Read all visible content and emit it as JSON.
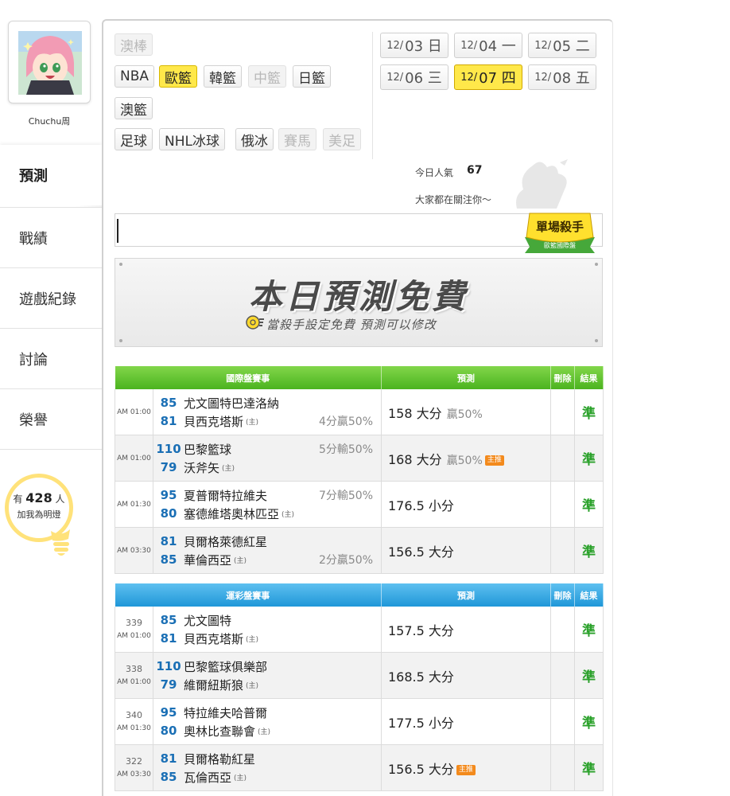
{
  "user": {
    "name": "Chuchu周"
  },
  "nav": [
    {
      "label": "預測",
      "active": true
    },
    {
      "label": "戰績"
    },
    {
      "label": "遊戲紀錄"
    },
    {
      "label": "討論"
    },
    {
      "label": "榮譽"
    }
  ],
  "fans": {
    "prefix": "有",
    "count": "428",
    "suffix": "人",
    "line2": "加我為明燈"
  },
  "sports": [
    {
      "label": "澳棒",
      "state": "disabled"
    },
    {
      "label": "NBA",
      "state": "normal"
    },
    {
      "label": "歐籃",
      "state": "selected"
    },
    {
      "label": "韓籃",
      "state": "normal"
    },
    {
      "label": "中籃",
      "state": "disabled"
    },
    {
      "label": "日籃",
      "state": "normal"
    },
    {
      "label": "澳籃",
      "state": "normal"
    },
    {
      "label": "足球",
      "state": "normal"
    },
    {
      "label": "NHL冰球",
      "state": "normal"
    },
    {
      "label": "俄冰",
      "state": "normal"
    },
    {
      "label": "賽馬",
      "state": "disabled"
    },
    {
      "label": "美足",
      "state": "disabled"
    }
  ],
  "dates": [
    {
      "md": "12/",
      "d": "03 日"
    },
    {
      "md": "12/",
      "d": "04 一"
    },
    {
      "md": "12/",
      "d": "05 二"
    },
    {
      "md": "12/",
      "d": "06 三"
    },
    {
      "md": "12/",
      "d": "07 四",
      "selected": true
    },
    {
      "md": "12/",
      "d": "08 五"
    }
  ],
  "popularity": {
    "label": "今日人氣",
    "value": "67",
    "sub": "大家都在關注你～"
  },
  "killer_badge": {
    "line1": "單場殺手",
    "line2": "歐籃國際盤"
  },
  "banner": {
    "title": "本日預測免費",
    "subtitle": "當殺手設定免費  預測可以修改"
  },
  "intl": {
    "headers": {
      "match": "國際盤賽事",
      "pred": "預測",
      "del": "刪除",
      "result": "結果"
    },
    "rows": [
      {
        "time": "AM 01:00",
        "s1": "85",
        "t1": "尤文圖特巴達洛納",
        "h1": "",
        "hcp1": "",
        "s2": "81",
        "t2": "貝西克塔斯",
        "h2": "(主)",
        "hcp2": "4分贏50%",
        "pred": "158 大分",
        "win": "贏50%",
        "badge": "",
        "result": "準"
      },
      {
        "time": "AM 01:00",
        "s1": "110",
        "t1": "巴黎籃球",
        "h1": "",
        "hcp1": "5分輸50%",
        "s2": "79",
        "t2": "沃斧矢",
        "h2": "(主)",
        "hcp2": "",
        "pred": "168 大分",
        "win": "贏50%",
        "badge": "主推",
        "result": "準"
      },
      {
        "time": "AM 01:30",
        "s1": "95",
        "t1": "夏普爾特拉維夫",
        "h1": "",
        "hcp1": "7分輸50%",
        "s2": "80",
        "t2": "塞德維塔奧林匹亞",
        "h2": "(主)",
        "hcp2": "",
        "pred": "176.5 小分",
        "win": "",
        "badge": "",
        "result": "準"
      },
      {
        "time": "AM 03:30",
        "s1": "81",
        "t1": "貝爾格萊德紅星",
        "h1": "",
        "hcp1": "",
        "s2": "85",
        "t2": "華倫西亞",
        "h2": "(主)",
        "hcp2": "2分贏50%",
        "pred": "156.5 大分",
        "win": "",
        "badge": "",
        "result": "準"
      }
    ]
  },
  "lottery": {
    "headers": {
      "match": "運彩盤賽事",
      "pred": "預測",
      "del": "刪除",
      "result": "結果"
    },
    "rows": [
      {
        "code": "339",
        "time": "AM 01:00",
        "s1": "85",
        "t1": "尤文圖特",
        "s2": "81",
        "t2": "貝西克塔斯",
        "h2": "(主)",
        "pred": "157.5 大分",
        "badge": "",
        "result": "準"
      },
      {
        "code": "338",
        "time": "AM 01:00",
        "s1": "110",
        "t1": "巴黎籃球俱樂部",
        "s2": "79",
        "t2": "維爾紐斯狼",
        "h2": "(主)",
        "pred": "168.5 大分",
        "badge": "",
        "result": "準"
      },
      {
        "code": "340",
        "time": "AM 01:30",
        "s1": "95",
        "t1": "特拉維夫哈普爾",
        "s2": "80",
        "t2": "奧林比查聯會",
        "h2": "(主)",
        "pred": "177.5 小分",
        "badge": "",
        "result": "準"
      },
      {
        "code": "322",
        "time": "AM 03:30",
        "s1": "81",
        "t1": "貝爾格勒紅星",
        "s2": "85",
        "t2": "瓦倫西亞",
        "h2": "(主)",
        "pred": "156.5 大分",
        "badge": "主推",
        "result": "準"
      }
    ]
  }
}
